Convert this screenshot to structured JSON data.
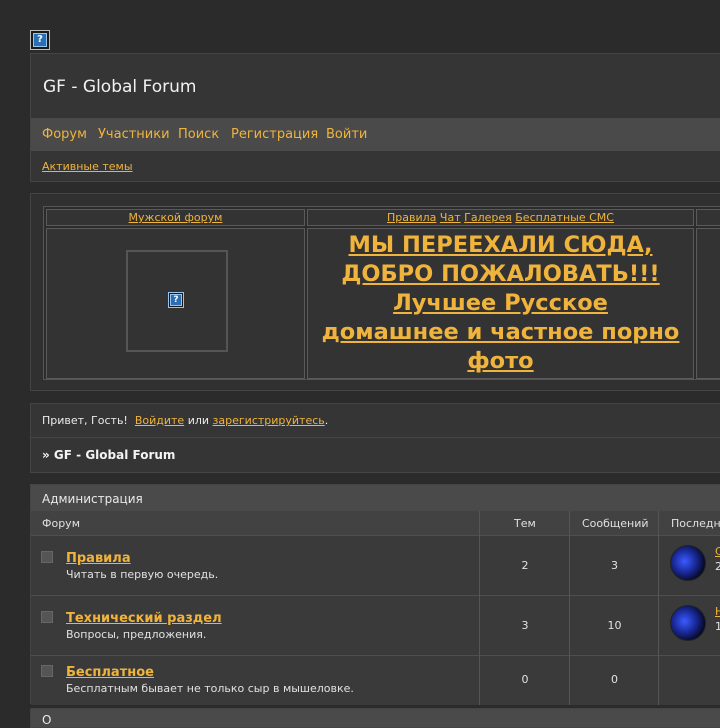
{
  "header": {
    "site_title": "GF - Global Forum",
    "nav": [
      "Форум",
      "Участники",
      "Поиск",
      "Регистрация",
      "Войти"
    ],
    "active_topics": "Активные темы"
  },
  "banner": {
    "mens_forum": "Мужской форум",
    "links": [
      "Правила",
      "Чат",
      "Галерея",
      "Бесплатные СМС"
    ],
    "promo_lines": [
      "МЫ ПЕРЕЕХАЛИ СЮДА,",
      "ДОБРО ПОЖАЛОВАТЬ!!!",
      "Лучшее Русское",
      "домашнее и частное порно",
      "фото"
    ]
  },
  "greeting": {
    "hello": "Привет, Гость!",
    "login_link": "Войдите",
    "or": "или",
    "register_link": "зарегистрируйтесь",
    "period": "."
  },
  "breadcrumb": "» GF - Global Forum",
  "category": {
    "title": "Администрация",
    "columns": [
      "Форум",
      "Тем",
      "Сообщений",
      "Последн"
    ],
    "forums": [
      {
        "name": "Правила",
        "desc": "Читать в первую очередь.",
        "topics": "2",
        "posts": "3",
        "last_link": "С",
        "last_meta": "2"
      },
      {
        "name": "Технический раздел",
        "desc": "Вопросы, предложения.",
        "topics": "3",
        "posts": "10",
        "last_link": "Н",
        "last_meta": "1"
      },
      {
        "name": "Бесплатное",
        "desc": "Бесплатным бывает не только сыр в мышеловке.",
        "topics": "0",
        "posts": "0",
        "last_link": "",
        "last_meta": ""
      }
    ]
  },
  "next_category": {
    "title": "О"
  },
  "icons": {
    "broken_image": "broken-image-icon",
    "forum_status": "forum-status-icon",
    "avatar": "user-avatar"
  }
}
